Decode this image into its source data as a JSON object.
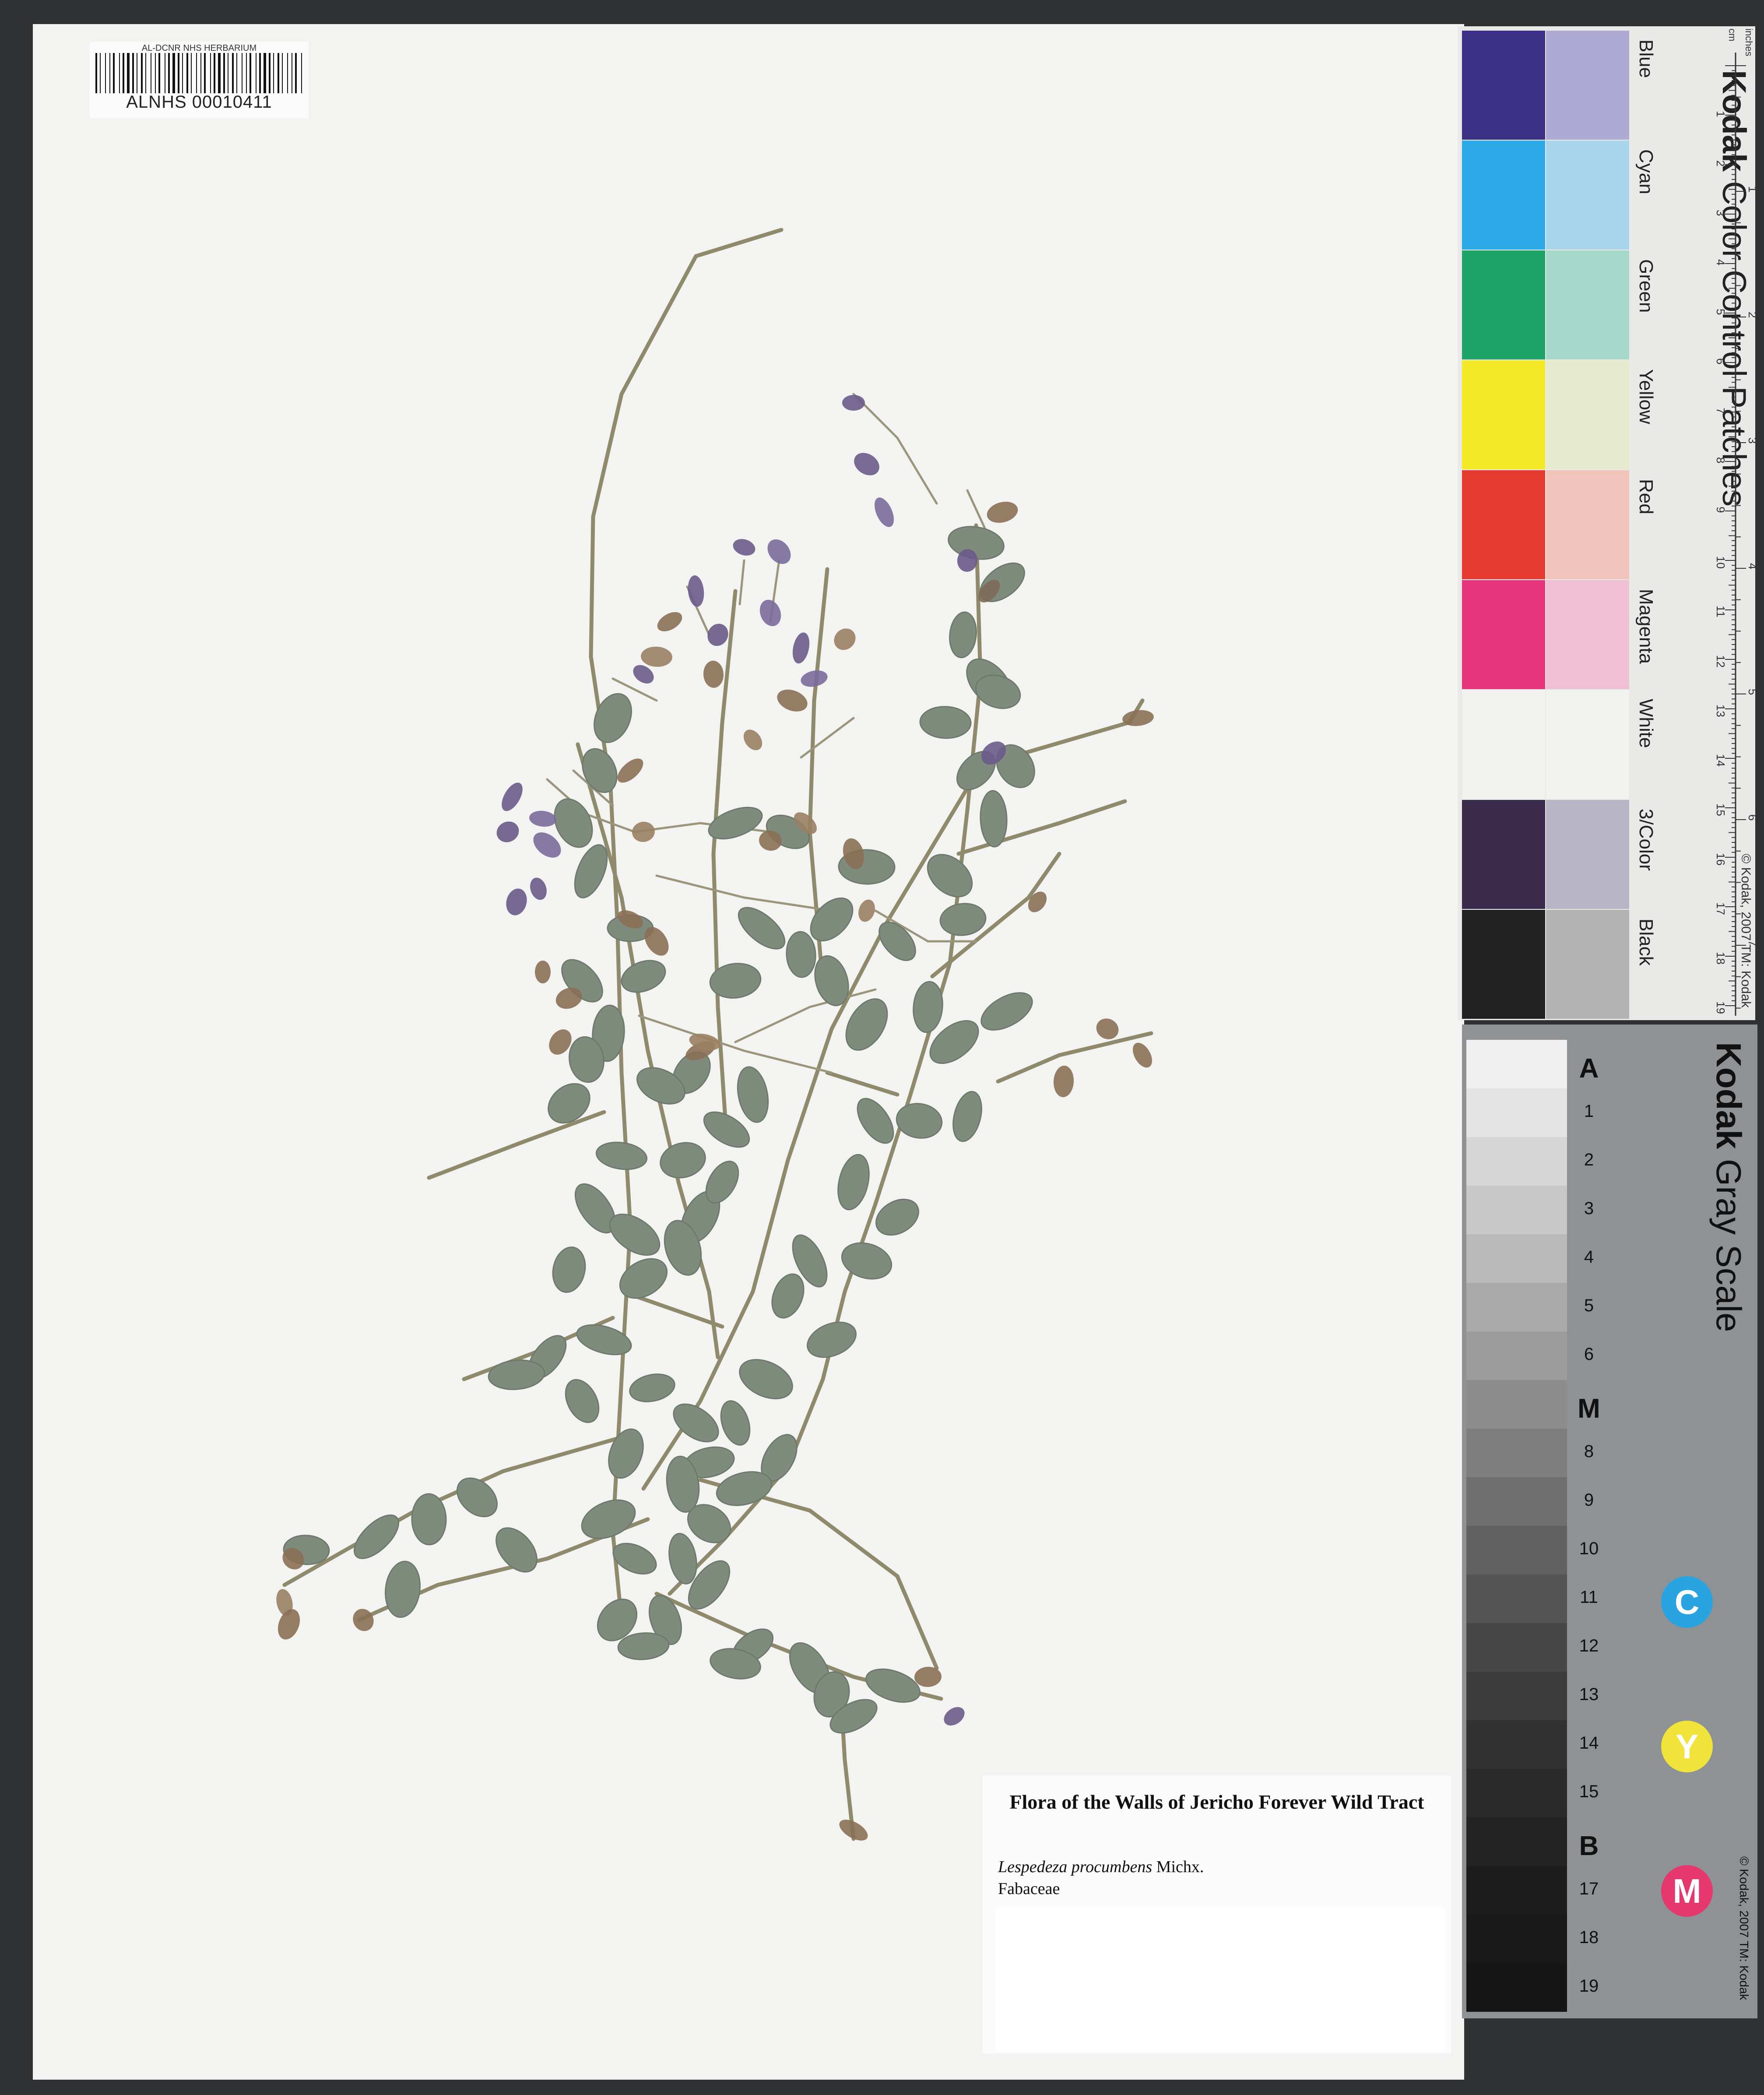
{
  "barcode": {
    "herbarium": "AL-DCNR NHS HERBARIUM",
    "catalog_number": "ALNHS 00010411"
  },
  "label": {
    "title": "Flora of the Walls of Jericho Forever Wild Tract",
    "species": "Lespedeza procumbens",
    "authority": "Michx.",
    "family": "Fabaceae"
  },
  "color_card": {
    "brand": "Kodak",
    "title": "Color Control Patches",
    "copyright": "© Kodak, 2007 TM: Kodak",
    "unit_cm": "cm",
    "unit_inches": "inches",
    "patches": [
      {
        "name": "Blue",
        "color": "#3b2f86",
        "tint": "#aeaad4"
      },
      {
        "name": "Cyan",
        "color": "#2ba9e6",
        "tint": "#a9d5ec"
      },
      {
        "name": "Green",
        "color": "#1ea267",
        "tint": "#a6d9c9"
      },
      {
        "name": "Yellow",
        "color": "#f2ea24",
        "tint": "#e6ebce"
      },
      {
        "name": "Red",
        "color": "#e53a2f",
        "tint": "#f0c3bb"
      },
      {
        "name": "Magenta",
        "color": "#e7357c",
        "tint": "#efbfd3"
      },
      {
        "name": "White",
        "color": "#f1f1ef",
        "tint": "#f1f1ef"
      },
      {
        "name": "3/Color",
        "color": "#3a2a4c",
        "tint": "#b8b6c4"
      },
      {
        "name": "Black",
        "color": "#222222",
        "tint": "#b3b3b3"
      }
    ],
    "cm_ticks": [
      "1",
      "2",
      "3",
      "4",
      "5",
      "6",
      "7",
      "8",
      "9",
      "10",
      "11",
      "12",
      "13",
      "14",
      "15",
      "16",
      "17",
      "18",
      "19"
    ],
    "inch_ticks": [
      "1",
      "2",
      "3",
      "4",
      "5",
      "6",
      "7",
      "8"
    ]
  },
  "gray_card": {
    "brand": "Kodak",
    "title": "Gray Scale",
    "copyright": "© Kodak, 2007 TM: Kodak",
    "steps": [
      "A",
      "1",
      "2",
      "3",
      "4",
      "5",
      "6",
      "M",
      "8",
      "9",
      "10",
      "11",
      "12",
      "13",
      "14",
      "15",
      "B",
      "17",
      "18",
      "19"
    ],
    "step_colors": [
      "#f0f0f0",
      "#e4e4e4",
      "#d6d6d6",
      "#c8c8c8",
      "#b9b9b9",
      "#aaaaaa",
      "#9c9c9c",
      "#8d8d8d",
      "#7e7e7e",
      "#6f6f6f",
      "#616161",
      "#545454",
      "#474747",
      "#3c3c3c",
      "#323232",
      "#2a2a2a",
      "#232323",
      "#1d1d1d",
      "#191919",
      "#161616"
    ],
    "cym": [
      {
        "letter": "C",
        "color": "#2aa3e1"
      },
      {
        "letter": "Y",
        "color": "#f0e33a"
      },
      {
        "letter": "M",
        "color": "#e4386e"
      }
    ]
  }
}
